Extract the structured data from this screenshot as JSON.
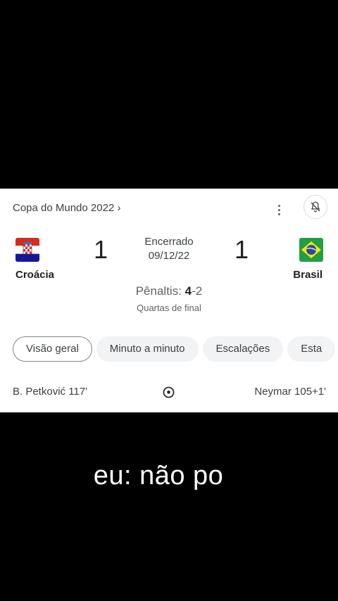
{
  "header": {
    "competition": "Copa do Mundo 2022",
    "chevron": "›",
    "menu_icon": "more-vert-icon",
    "bell_icon": "notifications-off-icon"
  },
  "match": {
    "home": {
      "name": "Croácia",
      "score": "1",
      "flag": "croatia-flag-icon"
    },
    "away": {
      "name": "Brasil",
      "score": "1",
      "flag": "brazil-flag-icon"
    },
    "status": "Encerrado",
    "date": "09/12/22",
    "penalties_label": "Pênaltis:",
    "penalties_home": "4",
    "penalties_sep": "-",
    "penalties_away": "2",
    "stage": "Quartas de final"
  },
  "tabs": [
    {
      "label": "Visão geral",
      "active": true
    },
    {
      "label": "Minuto a minuto",
      "active": false
    },
    {
      "label": "Escalações",
      "active": false
    },
    {
      "label": "Esta",
      "active": false
    }
  ],
  "goals": {
    "home": "B. Petković 117'",
    "away": "Neymar 105+1'",
    "icon": "soccer-ball-icon"
  },
  "caption": "eu: não po",
  "colors": {
    "background": "#000000",
    "card": "#ffffff",
    "chip": "#f1f3f4",
    "text": "#202124"
  }
}
